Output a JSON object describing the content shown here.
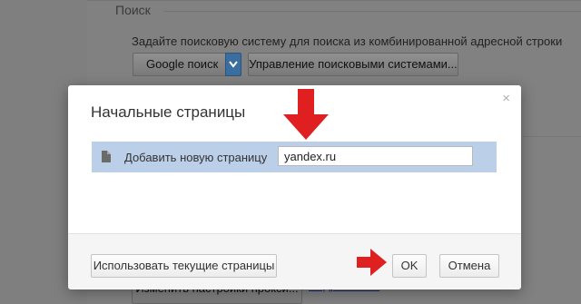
{
  "background": {
    "section_title": "Поиск",
    "search_description": "Задайте поисковую систему для поиска из комбинированной адресной строки",
    "search_engine_select": "Google поиск",
    "manage_engines_button": "Управление поисковыми системами...",
    "proxy_button": "Изменить настройки прокси...",
    "more_link": "Подробнее..."
  },
  "dialog": {
    "title": "Начальные страницы",
    "close_glyph": "×",
    "row": {
      "icon": "page-icon",
      "label": "Добавить новую страницу",
      "input_value": "yandex.ru"
    },
    "footer": {
      "use_current_button": "Использовать текущие страницы",
      "ok_button": "OK",
      "cancel_button": "Отмена"
    }
  },
  "annotations": {
    "arrow_color": "#e02020"
  },
  "colors": {
    "row_highlight": "#bccfe8",
    "overlay": "#7f7f7f"
  }
}
